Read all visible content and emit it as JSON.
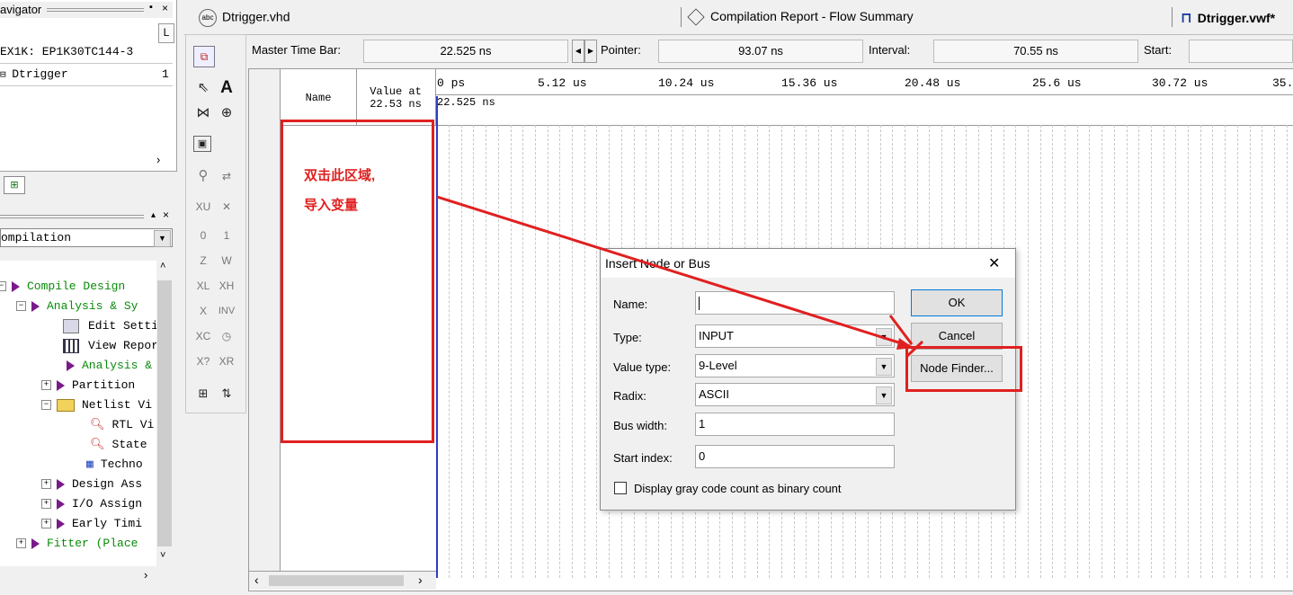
{
  "navigator": {
    "title": "avigator",
    "col_header": "L",
    "device": "EX1K: EP1K30TC144-3",
    "entity": "Dtrigger",
    "entity_level": "1"
  },
  "tasks": {
    "dropdown_value": "ompilation",
    "items": [
      {
        "label": "Compile Design",
        "color": "green"
      },
      {
        "label": "Analysis & Sy",
        "color": "green"
      },
      {
        "label": "Edit Setti",
        "color": "black"
      },
      {
        "label": "View Repor",
        "color": "black"
      },
      {
        "label": "Analysis &",
        "color": "green"
      },
      {
        "label": "Partition",
        "color": "black"
      },
      {
        "label": "Netlist Vi",
        "color": "black"
      },
      {
        "label": "RTL Vi",
        "color": "black"
      },
      {
        "label": "State",
        "color": "black"
      },
      {
        "label": "Techno",
        "color": "black"
      },
      {
        "label": "Design Ass",
        "color": "black"
      },
      {
        "label": "I/O Assign",
        "color": "black"
      },
      {
        "label": "Early Timi",
        "color": "black"
      },
      {
        "label": "Fitter (Place",
        "color": "green"
      }
    ]
  },
  "tabs": [
    {
      "label": "Dtrigger.vhd"
    },
    {
      "label": "Compilation Report - Flow Summary"
    },
    {
      "label": "Dtrigger.vwf*"
    }
  ],
  "master_bar": {
    "master_label": "Master Time Bar:",
    "master_value": "22.525 ns",
    "pointer_label": "Pointer:",
    "pointer_value": "93.07 ns",
    "interval_label": "Interval:",
    "interval_value": "70.55 ns",
    "start_label": "Start:"
  },
  "waveform": {
    "name_header": "Name",
    "value_header_1": "Value at",
    "value_header_2": "22.53 ns",
    "time_ticks": [
      "0 ps",
      "5.12 us",
      "10.24 us",
      "15.36 us",
      "20.48 us",
      "25.6 us",
      "30.72 us",
      "35."
    ],
    "cursor_label": "22.525 ns"
  },
  "annotation": {
    "line1": "双击此区域,",
    "line2": "导入变量"
  },
  "dialog": {
    "title": "Insert Node or Bus",
    "name_label": "Name:",
    "name_value": "",
    "type_label": "Type:",
    "type_value": "INPUT",
    "value_type_label": "Value type:",
    "value_type_value": "9-Level",
    "radix_label": "Radix:",
    "radix_value": "ASCII",
    "bus_width_label": "Bus width:",
    "bus_width_value": "1",
    "start_index_label": "Start index:",
    "start_index_value": "0",
    "checkbox_label": "Display gray code count as binary count",
    "ok_label": "OK",
    "cancel_label": "Cancel",
    "node_finder_label": "Node Finder...",
    "close_symbol": "✕"
  },
  "colors": {
    "annotation_red": "#e02020",
    "task_green": "#0a8a0a",
    "task_arrow": "#7a1a8a"
  }
}
